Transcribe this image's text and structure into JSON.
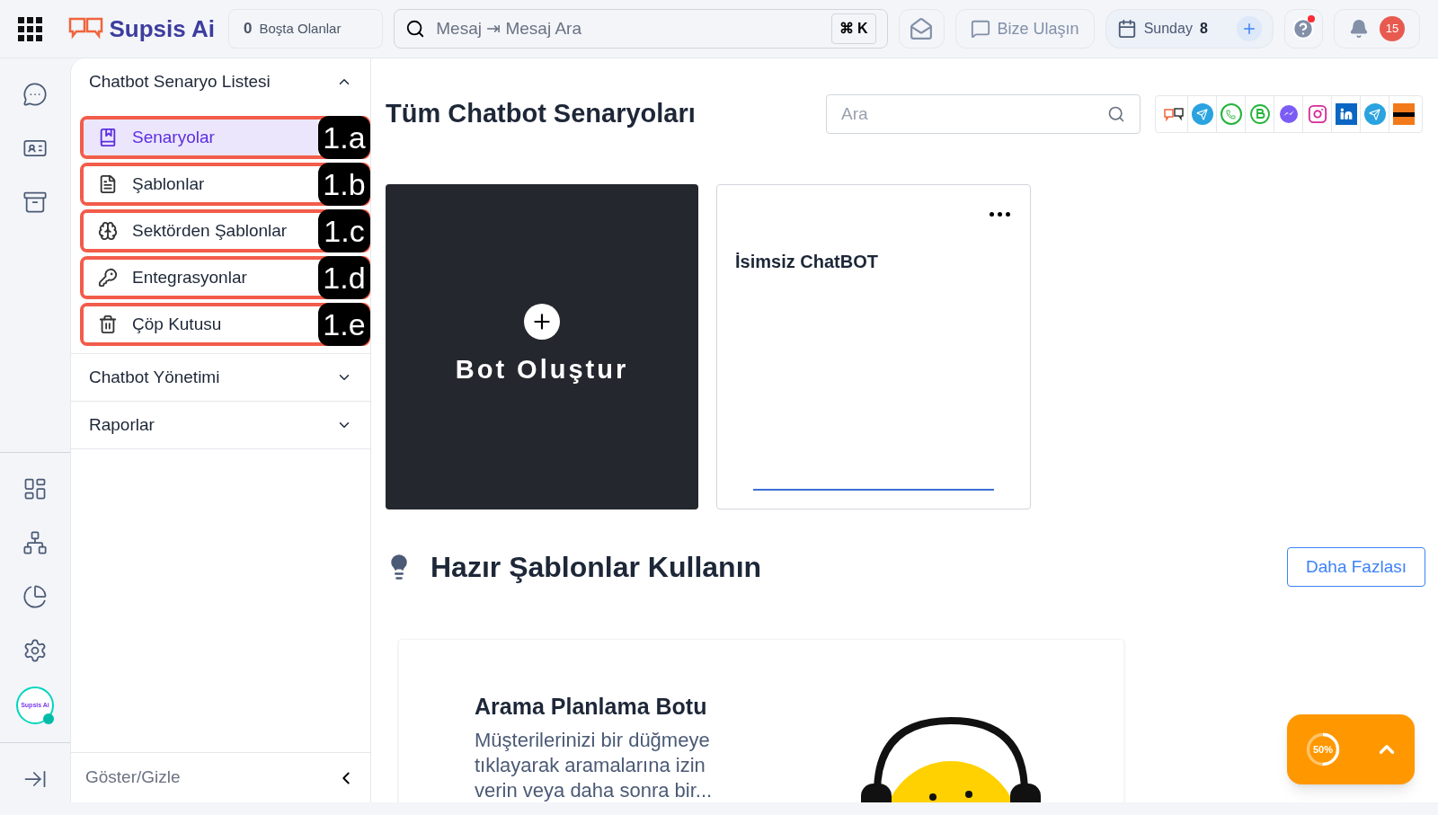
{
  "topbar": {
    "logo": "Supsis Ai",
    "idle": {
      "count": "0",
      "label": "Boşta Olanlar"
    },
    "search": {
      "placeholder": "Mesaj ⇥ Mesaj Ara",
      "shortcut": "⌘ K"
    },
    "contact": "Bize Ulaşın",
    "date": {
      "day": "Sunday",
      "number": "8"
    },
    "help_has_alert": true,
    "notifications": "15"
  },
  "rail": {
    "avatar_text": "Supsis Ai",
    "online": true
  },
  "sidebar": {
    "sections": [
      {
        "title": "Chatbot Senaryo Listesi",
        "expanded": true,
        "items": [
          {
            "label": "Senaryolar",
            "selected": true,
            "annotation": "1.a"
          },
          {
            "label": "Şablonlar",
            "selected": false,
            "annotation": "1.b"
          },
          {
            "label": "Sektörden Şablonlar",
            "selected": false,
            "annotation": "1.c"
          },
          {
            "label": "Entegrasyonlar",
            "selected": false,
            "annotation": "1.d"
          },
          {
            "label": "Çöp Kutusu",
            "selected": false,
            "annotation": "1.e"
          }
        ]
      },
      {
        "title": "Chatbot Yönetimi",
        "expanded": false
      },
      {
        "title": "Raporlar",
        "expanded": false
      }
    ],
    "footer": "Göster/Gizle"
  },
  "main": {
    "title": "Tüm Chatbot Senaryoları",
    "search": {
      "placeholder": "Ara"
    },
    "create_card": "Bot Oluştur",
    "bots": [
      {
        "name": "İsimsiz ChatBOT"
      }
    ],
    "templates": {
      "title": "Hazır Şablonlar Kullanın",
      "more": "Daha Fazlası",
      "cards": [
        {
          "title": "Arama Planlama Botu",
          "description": "Müşterilerinizi bir düğmeye tıklayarak aramalarına izin verin veya daha sonra bir..."
        }
      ]
    }
  },
  "progress_widget": {
    "reading": "50%",
    "level": 0.5
  }
}
